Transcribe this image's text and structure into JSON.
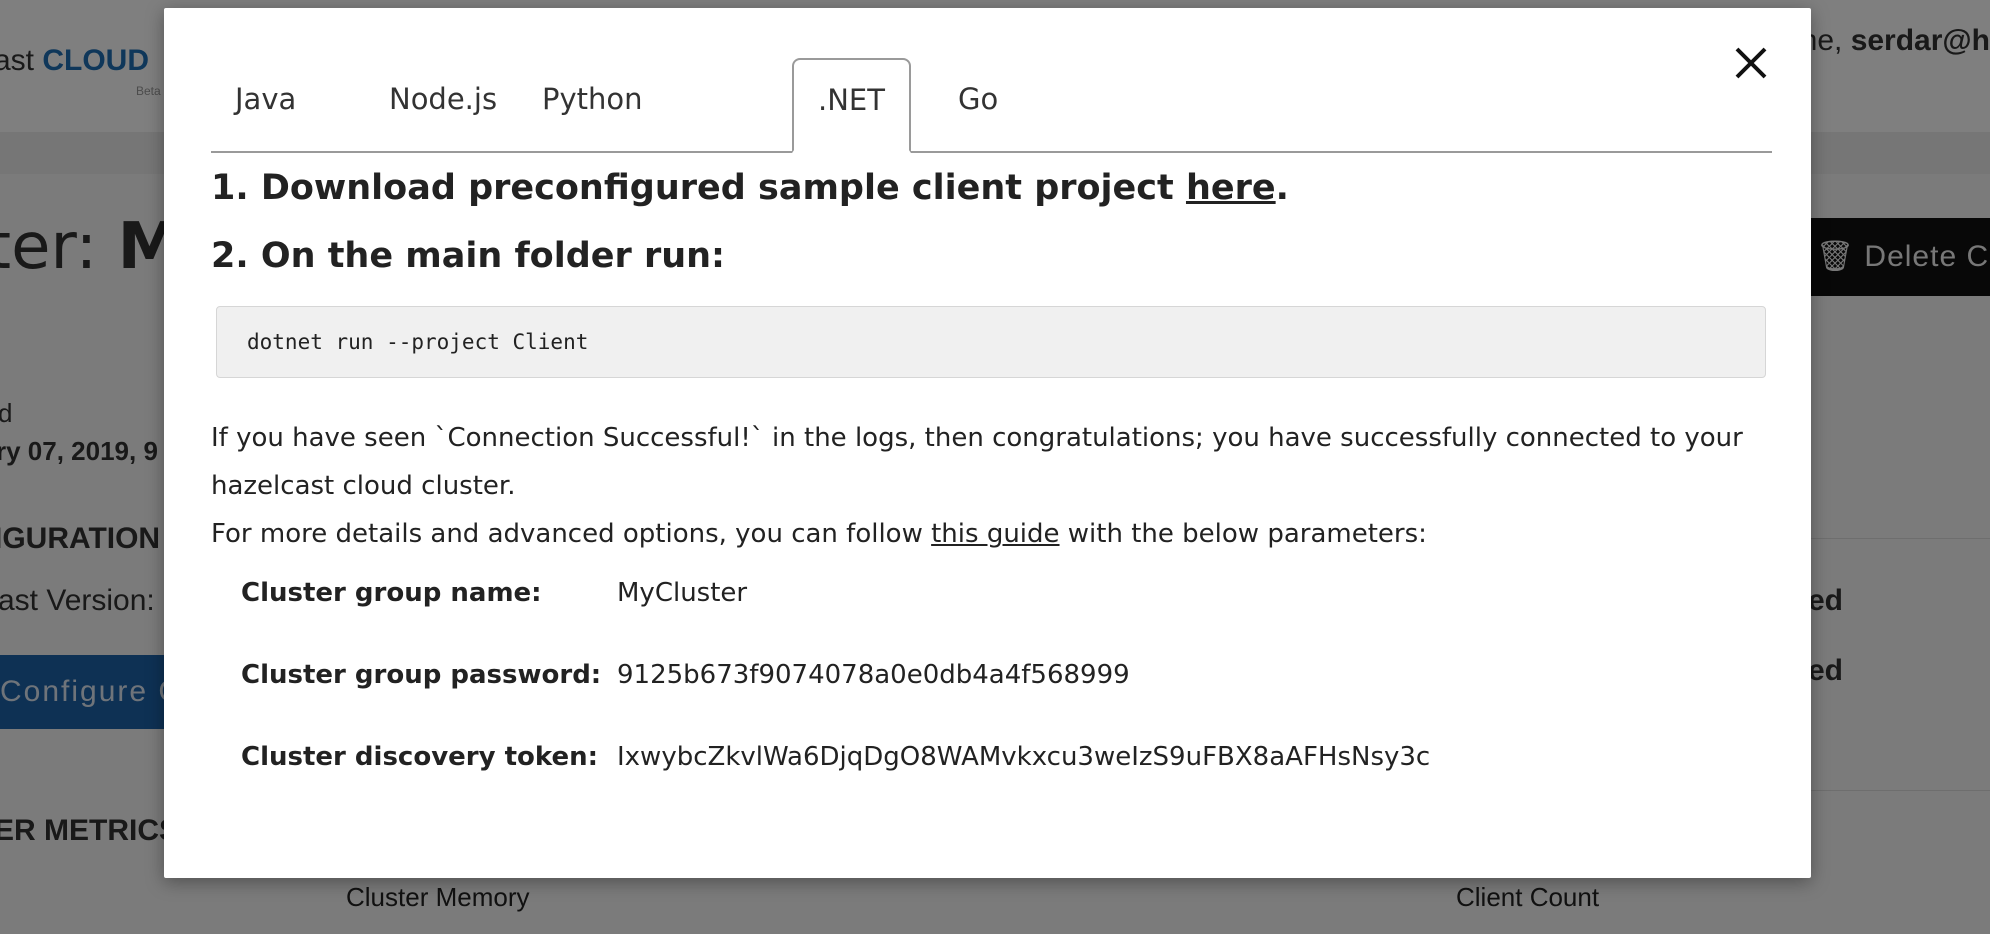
{
  "background": {
    "logo_left": "ast ",
    "logo_cloud": "CLOUD",
    "logo_sub": "Beta",
    "welcome_prefix": "me, ",
    "welcome_user": "serdar@h",
    "cluster_title_prefix": "ter: ",
    "cluster_title_name": "M",
    "delete_button": "Delete Clu",
    "label_created": "d",
    "created_date": "ry 07, 2019, 9",
    "config_heading": "IGURATION",
    "version_label": "ast Version:",
    "configure_button": "Configure C",
    "metrics_heading": "ER METRICS",
    "cluster_memory": "Cluster Memory",
    "client_count": "Client Count",
    "right_ed_1": "ed",
    "right_ed_2": "ed"
  },
  "modal": {
    "tabs": [
      {
        "label": "Java"
      },
      {
        "label": "Node.js"
      },
      {
        "label": "Python"
      },
      {
        "label": ".NET",
        "active": true
      },
      {
        "label": "Go"
      }
    ],
    "step1_text": "1. Download preconfigured sample client project ",
    "step1_link": "here",
    "step1_end": ".",
    "step2_text": "2. On the main folder run:",
    "command": "dotnet run --project Client",
    "success_text": "If you have seen `Connection Successful!` in the logs, then congratulations; you have successfully connected to your hazelcast cloud cluster.",
    "guide_prefix": "For more details and advanced options, you can follow ",
    "guide_link": "this guide",
    "guide_suffix": " with the below parameters:",
    "params": [
      {
        "label": "Cluster group name:",
        "value": "MyCluster"
      },
      {
        "label": "Cluster group password:",
        "value": "9125b673f9074078a0e0db4a4f568999"
      },
      {
        "label": "Cluster discovery token:",
        "value": "IxwybcZkvlWa6DjqDgO8WAMvkxcu3weIzS9uFBX8aAFHsNsy3c"
      }
    ]
  },
  "colors": {
    "accent_blue": "#1d63a8",
    "overlay": "rgba(0,0,0,0.5)"
  }
}
